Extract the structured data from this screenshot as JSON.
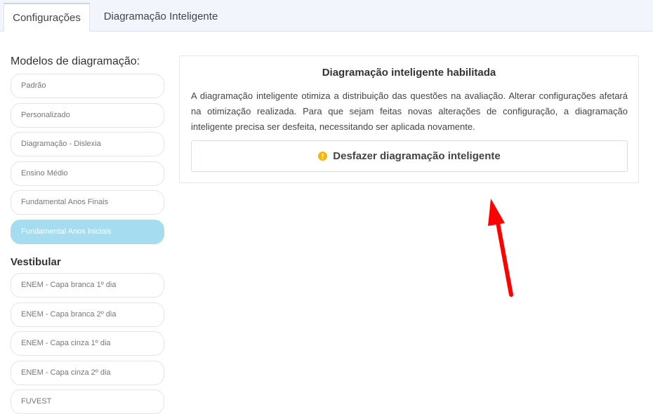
{
  "tabs": [
    {
      "label": "Configurações",
      "active": true
    },
    {
      "label": "Diagramação Inteligente",
      "active": false
    }
  ],
  "sidebar": {
    "models_title": "Modelos de diagramação:",
    "models": [
      {
        "label": "Padrão"
      },
      {
        "label": "Personalizado"
      },
      {
        "label": "Diagramação - Dislexia"
      },
      {
        "label": "Ensino Médio"
      },
      {
        "label": "Fundamental Anos Finais"
      },
      {
        "label": "Fundamental Anos Iniciais",
        "selected": true
      }
    ],
    "vestibular_title": "Vestibular",
    "vestibular": [
      {
        "label": "ENEM - Capa branca 1º dia"
      },
      {
        "label": "ENEM - Capa branca 2º dia"
      },
      {
        "label": "ENEM - Capa cinza 1º dia"
      },
      {
        "label": "ENEM - Capa cinza 2º dia"
      },
      {
        "label": "FUVEST"
      }
    ]
  },
  "panel": {
    "title": "Diagramação inteligente habilitada",
    "description": "A diagramação inteligente otimiza a distribuição das questões na avaliação. Alterar configurações afetará na otimização realizada. Para que sejam feitas novas alterações de configuração, a diagramação inteligente precisa ser desfeita, necessitando ser aplicada novamente.",
    "undo_button": "Desfazer diagramação inteligente",
    "undo_icon": "warning-icon"
  },
  "colors": {
    "selected_model": "#a6dcef",
    "warning_icon": "#f5b50a",
    "annotation_arrow": "#ff0000"
  }
}
